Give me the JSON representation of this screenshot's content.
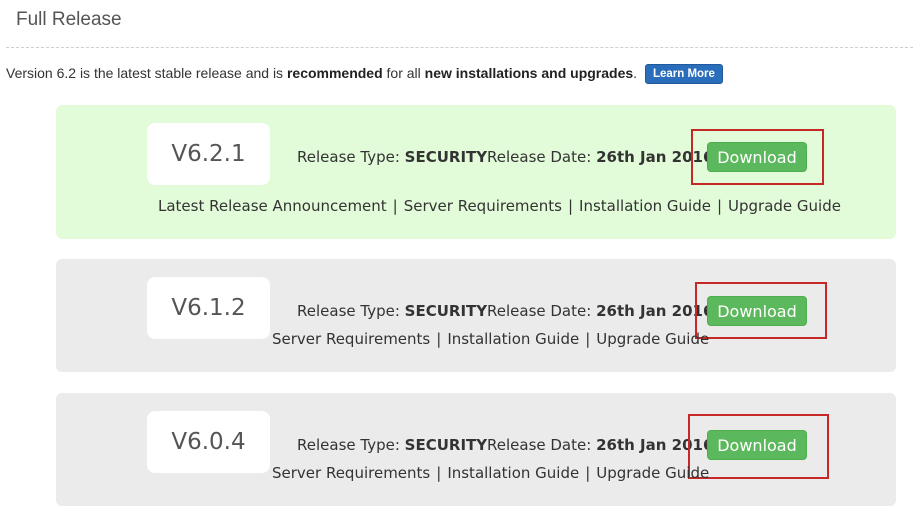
{
  "page": {
    "title": "Full Release",
    "intro": {
      "prefix": "Version 6.2 is the latest stable release and is ",
      "bold1": "recommended",
      "middle": " for all ",
      "bold2": "new installations and upgrades",
      "suffix": ".",
      "learn_more_label": "Learn More"
    }
  },
  "labels": {
    "release_type": "Release Type:",
    "release_date": "Release Date:",
    "download": "Download"
  },
  "releases": [
    {
      "version": "V6.2.1",
      "release_type": "SECURITY",
      "release_date": "26th Jan 2016",
      "links": [
        "Latest Release Announcement",
        "Server Requirements",
        "Installation Guide",
        "Upgrade Guide"
      ]
    },
    {
      "version": "V6.1.2",
      "release_type": "SECURITY",
      "release_date": "26th Jan 2016",
      "links": [
        "Server Requirements",
        "Installation Guide",
        "Upgrade Guide"
      ]
    },
    {
      "version": "V6.0.4",
      "release_type": "SECURITY",
      "release_date": "26th Jan 2016",
      "links": [
        "Server Requirements",
        "Installation Guide",
        "Upgrade Guide"
      ]
    }
  ],
  "colors": {
    "latest_card_bg": "#e2fbd8",
    "card_bg": "#ebebeb",
    "download_button": "#5cb85c",
    "learn_more_button": "#2a6ebb",
    "highlight_outline": "#c62828"
  }
}
